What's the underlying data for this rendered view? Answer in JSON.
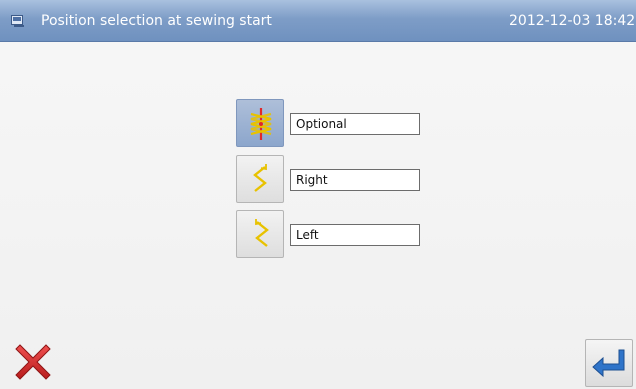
{
  "header": {
    "title": "Position selection at sewing start",
    "datetime": "2012-12-03  18:42",
    "icon": "panel-icon"
  },
  "options": [
    {
      "label": "Optional",
      "icon": "optional-stitch-icon",
      "selected": true
    },
    {
      "label": "Right",
      "icon": "right-start-stitch-icon",
      "selected": false
    },
    {
      "label": "Left",
      "icon": "left-start-stitch-icon",
      "selected": false
    }
  ],
  "footer": {
    "cancel_icon": "close-icon",
    "enter_icon": "enter-icon"
  },
  "colors": {
    "titlebar": "#7e9dc7",
    "selected_button": "#9bb1d3",
    "cancel_red": "#d62b2b",
    "enter_blue": "#2f74c9",
    "stitch_yellow": "#e8c200",
    "stitch_red": "#e0282a"
  }
}
